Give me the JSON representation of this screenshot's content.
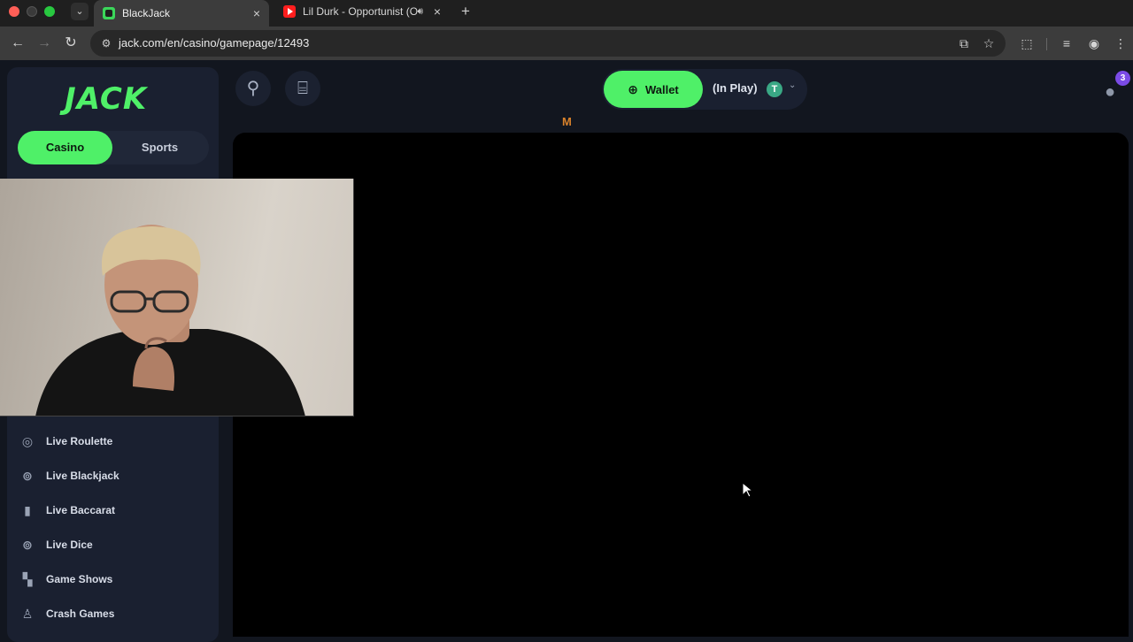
{
  "browser": {
    "tabs": [
      {
        "title": "BlackJack",
        "active": true
      },
      {
        "title": "Lil Durk - Opportunist (Of",
        "active": false
      }
    ],
    "url": "jack.com/en/casino/gamepage/12493"
  },
  "site": {
    "logo": "JACK",
    "mode_switch": {
      "casino": "Casino",
      "sports": "Sports"
    },
    "nav_items": [
      {
        "label": "Live Roulette",
        "icon": "roulette-icon"
      },
      {
        "label": "Live Blackjack",
        "icon": "live-icon"
      },
      {
        "label": "Live Baccarat",
        "icon": "card-icon"
      },
      {
        "label": "Live Dice",
        "icon": "live-icon"
      },
      {
        "label": "Game Shows",
        "icon": "cards-icon"
      },
      {
        "label": "Crash Games",
        "icon": "joystick-icon"
      }
    ],
    "header": {
      "wallet_label": "Wallet",
      "status": "(In Play)",
      "currency_symbol": "T",
      "notification_count": "3",
      "loader_mark": "M"
    }
  },
  "colors": {
    "accent": "#4ff068",
    "sidebar_bg": "#1a2030",
    "page_bg": "#12161f",
    "badge": "#7b4be6"
  }
}
